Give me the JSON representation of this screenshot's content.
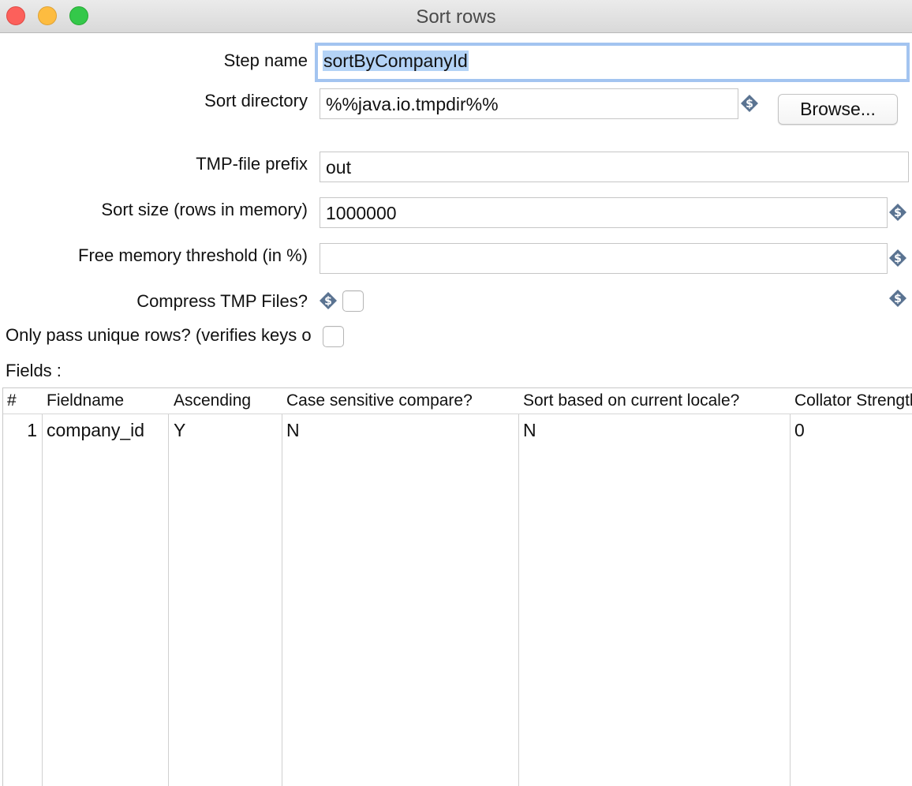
{
  "window": {
    "title": "Sort rows"
  },
  "form": {
    "step_name": {
      "label": "Step name",
      "value": "sortByCompanyId"
    },
    "sort_directory": {
      "label": "Sort directory",
      "value": "%%java.io.tmpdir%%",
      "browse_label": "Browse..."
    },
    "tmp_prefix": {
      "label": "TMP-file prefix",
      "value": "out"
    },
    "sort_size": {
      "label": "Sort size (rows in memory)",
      "value": "1000000"
    },
    "free_memory": {
      "label": "Free memory threshold (in %)",
      "value": ""
    },
    "compress": {
      "label": "Compress TMP Files?",
      "checked": false
    },
    "unique_rows": {
      "label": "Only pass unique rows? (verifies keys only)",
      "checked": false
    },
    "fields_label": "Fields :"
  },
  "table": {
    "headers": [
      "#",
      "Fieldname",
      "Ascending",
      "Case sensitive compare?",
      "Sort based on current locale?",
      "Collator Strength"
    ],
    "rows": [
      [
        "1",
        "company_id",
        "Y",
        "N",
        "N",
        "0"
      ]
    ]
  },
  "icons": {
    "variable": "dollar-variable-icon"
  },
  "colors": {
    "focus_ring": "#a3c4f0",
    "selection": "#b4d3f6",
    "variable_icon": "#5a7391"
  }
}
